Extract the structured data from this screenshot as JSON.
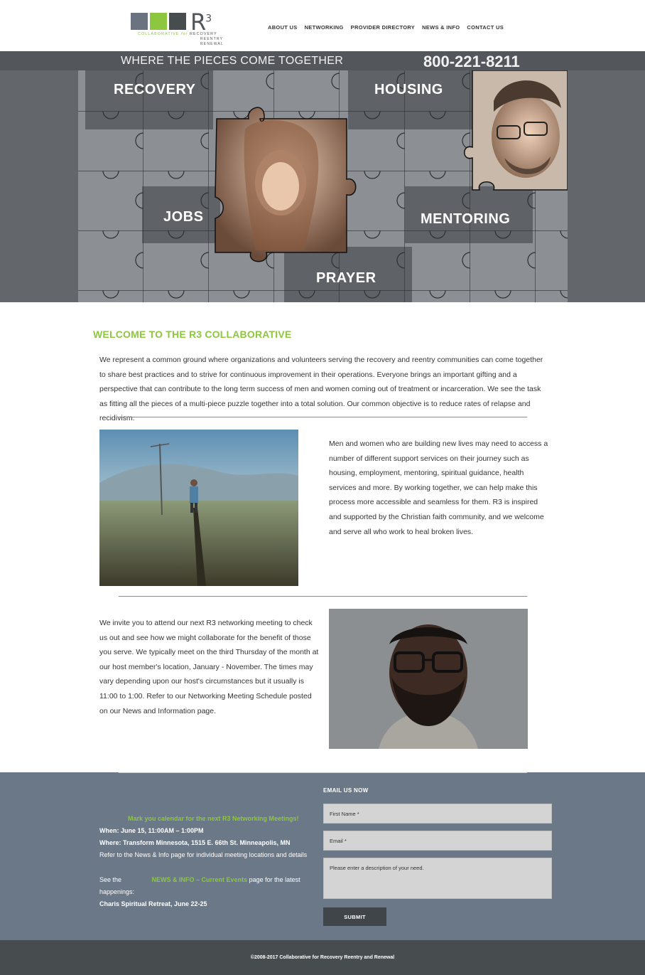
{
  "brand": {
    "logo_mark": "R",
    "logo_sup": "3",
    "logo_line1_a": "COLLABORATIVE",
    "logo_line1_b": "for",
    "logo_line1_c": "RECOVERY",
    "logo_line2": "REENTRY",
    "logo_line3": "RENEWAL",
    "colors": {
      "green": "#8dc63f",
      "slate": "#6b7380",
      "charcoal": "#474c4f"
    }
  },
  "nav": [
    "ABOUT US",
    "NETWORKING",
    "PROVIDER DIRECTORY",
    "NEWS & INFO",
    "CONTACT US"
  ],
  "hero": {
    "tagline": "WHERE THE PIECES COME TOGETHER",
    "phone": "800-221-8211",
    "words": [
      "RECOVERY",
      "HOUSING",
      "JOBS",
      "MENTORING",
      "PRAYER"
    ]
  },
  "welcome": {
    "title": "WELCOME TO THE R3 COLLABORATIVE",
    "intro": "We represent a common ground where organizations and volunteers serving the recovery and reentry communities can come together to share best practices and to strive for continuous improvement in their operations. Everyone brings an important gifting and a perspective that can contribute to the long term success of men and women coming out of treatment or incarceration. We see the task as fitting all the pieces of a multi-piece puzzle together into a total solution. Our common objective is to reduce rates of relapse and recidivism."
  },
  "section2": {
    "text": "Men and women who are building new lives may need to access a number of different support services on their journey such as housing, employment, mentoring, spiritual guidance, health services and more. By working together, we can help make this process more accessible and seamless for them. R3 is inspired and supported by the Christian faith community, and we welcome and serve all who work to heal broken lives."
  },
  "section3": {
    "text": "We invite you to attend our next R3 networking meeting to check us out and see how we might collaborate for the benefit of those you serve. We typically meet on the third Thursday of the month at our host member's location, January - November.  The times may vary depending upon our host's circumstances but it usually is 11:00 to 1:00.  Refer to our Networking Meeting Schedule posted on our News and Information page."
  },
  "calendar": {
    "heading": "Mark you calendar for the next R3 Networking Meetings!",
    "when": "When: June 15, 11:00AM – 1:00PM",
    "where": "Where: Transform Minnesota, 1515 E. 66th St. Minneapolis, MN",
    "refer": "Refer to the News & Info page for individual meeting locations and details",
    "see_pre": "See the",
    "see_link": "NEWS & INFO – Current Events",
    "see_post": "page for the latest",
    "see_post2": "happenings:",
    "event": "Charis Spiritual Retreat, June 22-25"
  },
  "form": {
    "title": "EMAIL US NOW",
    "first_name": "First Name *",
    "email": "Email *",
    "message": "Please enter a description of your need.",
    "submit": "SUBMIT"
  },
  "footer": {
    "copyright": "©2008-2017 Collaborative for Recovery Reentry and Renewal"
  }
}
